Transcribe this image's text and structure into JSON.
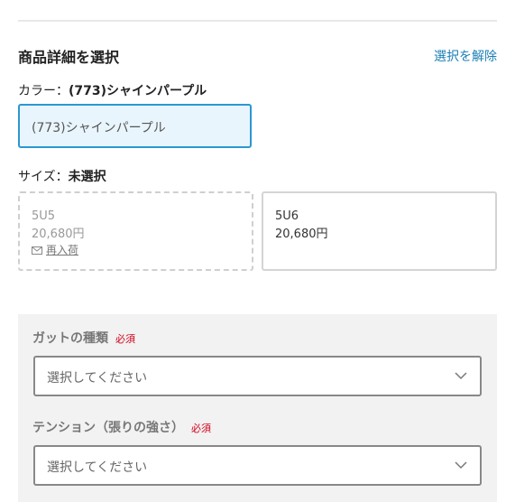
{
  "section": {
    "title": "商品詳細を選択",
    "clear_label": "選択を解除"
  },
  "color": {
    "label_prefix": "カラー：",
    "selected": "(773)シャインパープル",
    "chip_label": "(773)シャインパープル"
  },
  "size": {
    "label_prefix": "サイズ：",
    "selected": "未選択",
    "options": [
      {
        "name": "5U5",
        "price": "20,680円",
        "restock_label": "再入荷",
        "in_stock": false
      },
      {
        "name": "5U6",
        "price": "20,680円",
        "in_stock": true
      }
    ]
  },
  "options": {
    "gut": {
      "label": "ガットの種類",
      "required": "必須",
      "placeholder": "選択してください"
    },
    "tension": {
      "label": "テンション（張りの強さ）",
      "required": "必須",
      "placeholder": "選択してください"
    }
  },
  "colors": {
    "accent": "#2b97d3",
    "link": "#1a7fb5",
    "required": "#d0021b"
  },
  "icons": {
    "restock": "mail-icon",
    "dropdown": "chevron-down-icon"
  }
}
